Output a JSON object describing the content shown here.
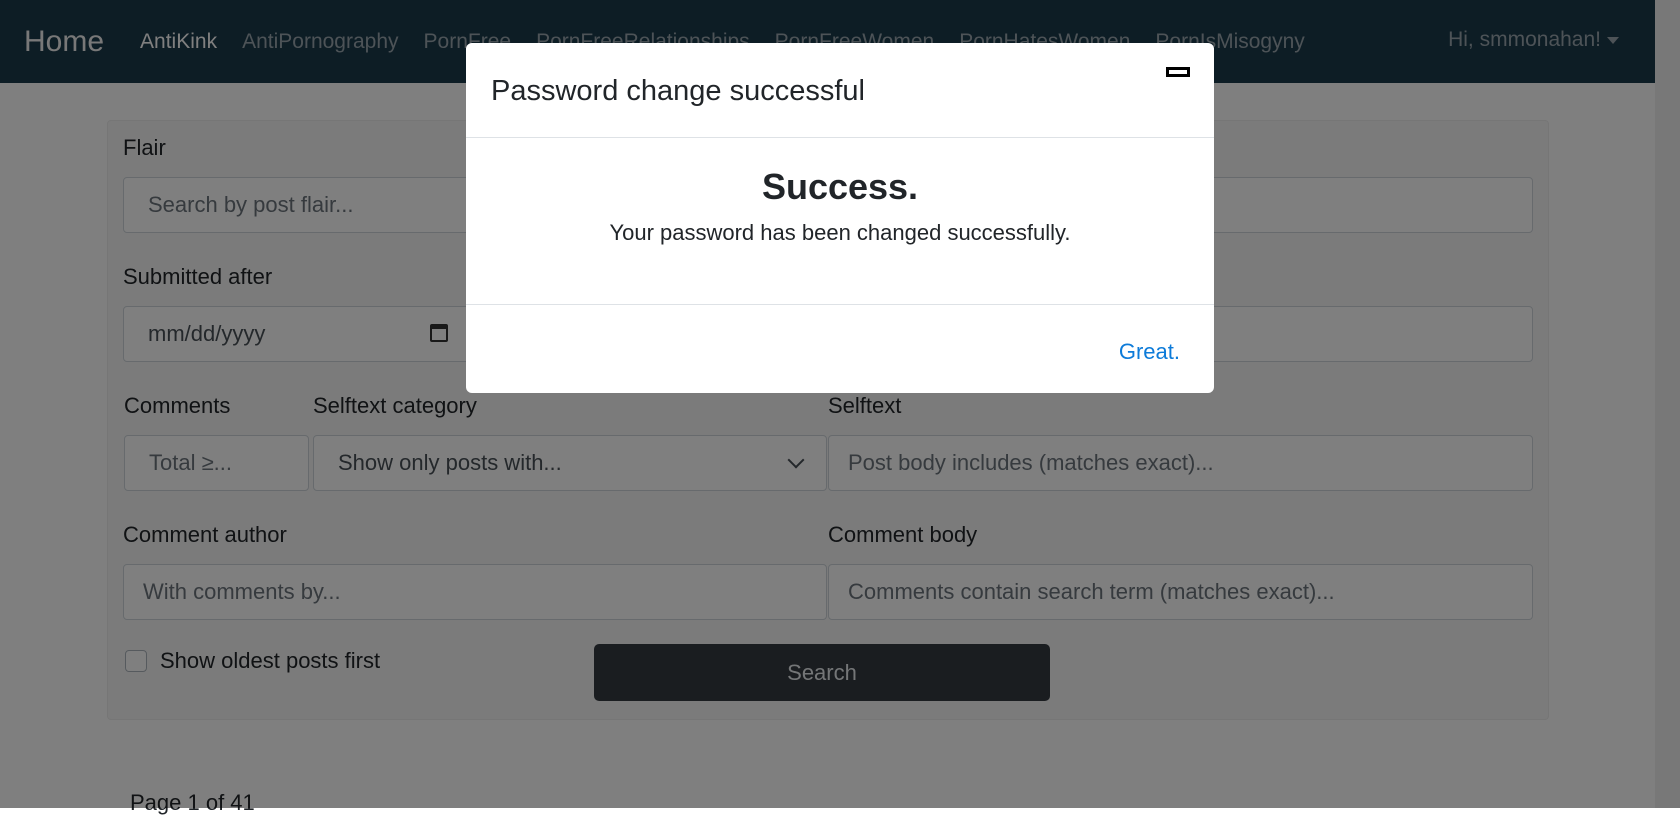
{
  "nav": {
    "brand": "Home",
    "links": [
      "AntiKink",
      "AntiPornography",
      "PornFree",
      "PornFreeRelationships",
      "PornFreeWomen",
      "PornHatesWomen",
      "PornIsMisogyny"
    ],
    "user_menu": "Hi, smmonahan!"
  },
  "form": {
    "flair_label": "Flair",
    "flair_placeholder": "Search by post flair...",
    "submitted_after_label": "Submitted after",
    "date_placeholder": "mm/dd/yyyy",
    "comments_label": "Comments",
    "comments_placeholder": "Total ≥...",
    "selftext_category_label": "Selftext category",
    "selftext_category_value": "Show only posts with...",
    "selftext_label": "Selftext",
    "selftext_placeholder": "Post body includes (matches exact)...",
    "comment_author_label": "Comment author",
    "comment_author_placeholder": "With comments by...",
    "comment_body_label": "Comment body",
    "comment_body_placeholder": "Comments contain search term (matches exact)...",
    "oldest_first_label": "Show oldest posts first",
    "search_label": "Search"
  },
  "pager": {
    "text": "Page 1 of 41"
  },
  "modal": {
    "title": "Password change successful",
    "heading": "Success.",
    "message": "Your password has been changed successfully.",
    "confirm_label": "Great."
  }
}
